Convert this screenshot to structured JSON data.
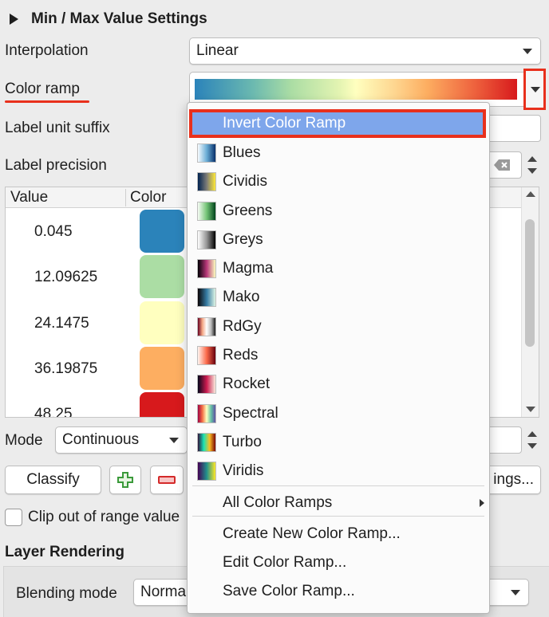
{
  "section": {
    "title": "Min / Max Value Settings"
  },
  "interpolation": {
    "label": "Interpolation",
    "value": "Linear"
  },
  "color_ramp": {
    "label": "Color ramp"
  },
  "label_unit_suffix": {
    "label": "Label unit suffix"
  },
  "label_precision": {
    "label": "Label precision"
  },
  "table": {
    "headers": [
      "Value",
      "Color"
    ],
    "rows": [
      {
        "value": "0.045",
        "color": "#2b83ba"
      },
      {
        "value": "12.09625",
        "color": "#abdda4"
      },
      {
        "value": "24.1475",
        "color": "#ffffbf"
      },
      {
        "value": "36.19875",
        "color": "#fdae61"
      },
      {
        "value": "48.25",
        "color": "#d7191c"
      }
    ]
  },
  "mode": {
    "label": "Mode",
    "value": "Continuous"
  },
  "buttons": {
    "classify": "Classify",
    "settings_partial": "ings..."
  },
  "clip": {
    "label": "Clip out of range value"
  },
  "layer_rendering": {
    "title": "Layer Rendering",
    "blending_label": "Blending mode",
    "blending_value": "Norma"
  },
  "menu": {
    "invert": "Invert Color Ramp",
    "ramps": [
      {
        "label": "Blues",
        "icon": "blues-ramp-icon",
        "gradient": "linear-gradient(to right,#f7fbff,#6baed6,#08306b)"
      },
      {
        "label": "Cividis",
        "icon": "cividis-ramp-icon",
        "gradient": "linear-gradient(to right,#00224e,#7c7b78,#fee838)"
      },
      {
        "label": "Greens",
        "icon": "greens-ramp-icon",
        "gradient": "linear-gradient(to right,#f7fcf5,#74c476,#00441b)"
      },
      {
        "label": "Greys",
        "icon": "greys-ramp-icon",
        "gradient": "linear-gradient(to right,#ffffff,#969696,#000000)"
      },
      {
        "label": "Magma",
        "icon": "magma-ramp-icon",
        "gradient": "linear-gradient(to right,#000004,#b73779,#fcfdbf)"
      },
      {
        "label": "Mako",
        "icon": "mako-ramp-icon",
        "gradient": "linear-gradient(to right,#0b0405,#357ba3,#def5e5)"
      },
      {
        "label": "RdGy",
        "icon": "rdgy-ramp-icon",
        "gradient": "linear-gradient(to right,#67001f,#f4a582,#ffffff,#bababa,#1a1a1a)"
      },
      {
        "label": "Reds",
        "icon": "reds-ramp-icon",
        "gradient": "linear-gradient(to right,#fff5f0,#fb6a4a,#67000d)"
      },
      {
        "label": "Rocket",
        "icon": "rocket-ramp-icon",
        "gradient": "linear-gradient(to right,#03051a,#cb1b4f,#faebdd)"
      },
      {
        "label": "Spectral",
        "icon": "spectral-ramp-icon",
        "gradient": "linear-gradient(to right,#9e0142,#f46d43,#ffffbf,#66c2a5,#5e4fa2)"
      },
      {
        "label": "Turbo",
        "icon": "turbo-ramp-icon",
        "gradient": "linear-gradient(to right,#30123b,#1ae4b6,#fabd22,#7a0403)"
      },
      {
        "label": "Viridis",
        "icon": "viridis-ramp-icon",
        "gradient": "linear-gradient(to right,#440154,#21918c,#fde725)"
      }
    ],
    "all_ramps": "All Color Ramps",
    "create": "Create New Color Ramp...",
    "edit": "Edit Color Ramp...",
    "save": "Save Color Ramp..."
  }
}
